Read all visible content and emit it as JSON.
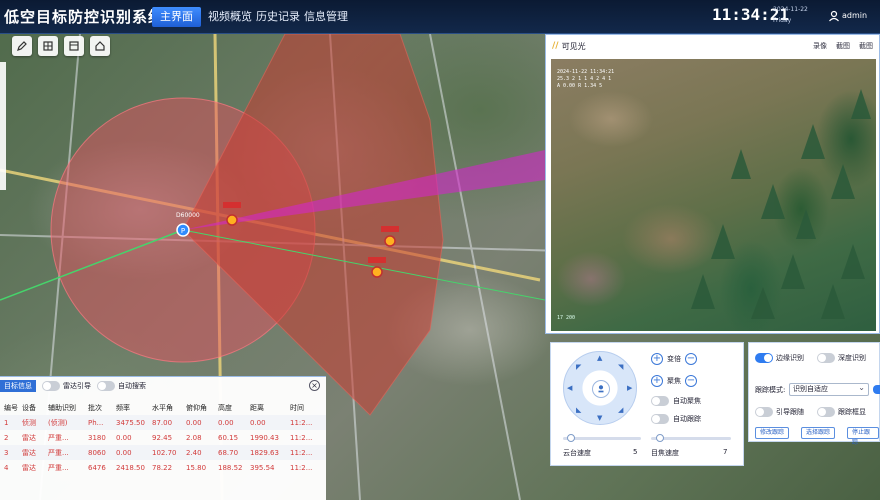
{
  "header": {
    "title": "低空目标防控识别系统",
    "nav": [
      "主界面",
      "视频概览",
      "历史记录",
      "信息管理"
    ],
    "active_nav": "主界面",
    "time": "11:34:21",
    "date": "2024-11-22",
    "weekday": "Friday",
    "user": "admin"
  },
  "map": {
    "station_marker": "P",
    "labels": [
      "D60000"
    ]
  },
  "video": {
    "title": "可见光",
    "actions": [
      "录像",
      "截图",
      "截图"
    ],
    "overlay_lines": [
      "2024-11-22 11:34:21",
      "25.3 2 1 1 4 2 4 1",
      "A 0.00 R 1.34 5"
    ],
    "corner_text": "17 200"
  },
  "ptz": {
    "zoom_label": "变倍",
    "focus_label": "聚焦",
    "auto_focus_label": "自动聚焦",
    "auto_track_label": "自动跟踪",
    "speed_label": "云台速度",
    "speed_value": "5",
    "speed_fraction": 0.05,
    "zoom_speed_label": "目焦速度",
    "zoom_speed_value": "7",
    "zoom_speed_fraction": 0.07
  },
  "detect": {
    "edge_detect": "边缘识别",
    "deep_detect": "深度识别",
    "mode_label": "跟踪模式:",
    "mode_value": "识别自适应",
    "guide_label": "引导跟随",
    "track_box_label": "跟踪框显",
    "buttons": [
      "修改跟踪",
      "选择跟踪",
      "停止跟踪"
    ]
  },
  "list": {
    "tab": "目标信息",
    "opt_radar": "雷达引导",
    "opt_auto": "自动搜索",
    "columns": [
      "编号",
      "设备",
      "辅助识别",
      "批次",
      "频率",
      "水平角",
      "俯仰角",
      "高度",
      "距离",
      "时间"
    ],
    "rows": [
      [
        "1",
        "侦测",
        "(侦测)",
        "Ph...",
        "3475.50",
        "87.00",
        "0.00",
        "0.00",
        "0.00",
        "11:2..."
      ],
      [
        "2",
        "雷达",
        "严重...",
        "3180",
        "0.00",
        "92.45",
        "2.08",
        "60.15",
        "1990.43",
        "11:2..."
      ],
      [
        "3",
        "雷达",
        "严重...",
        "8060",
        "0.00",
        "102.70",
        "2.40",
        "68.70",
        "1829.63",
        "11:2..."
      ],
      [
        "4",
        "雷达",
        "严重...",
        "6476",
        "2418.50",
        "78.22",
        "15.80",
        "188.52",
        "395.54",
        "11:2..."
      ]
    ]
  }
}
